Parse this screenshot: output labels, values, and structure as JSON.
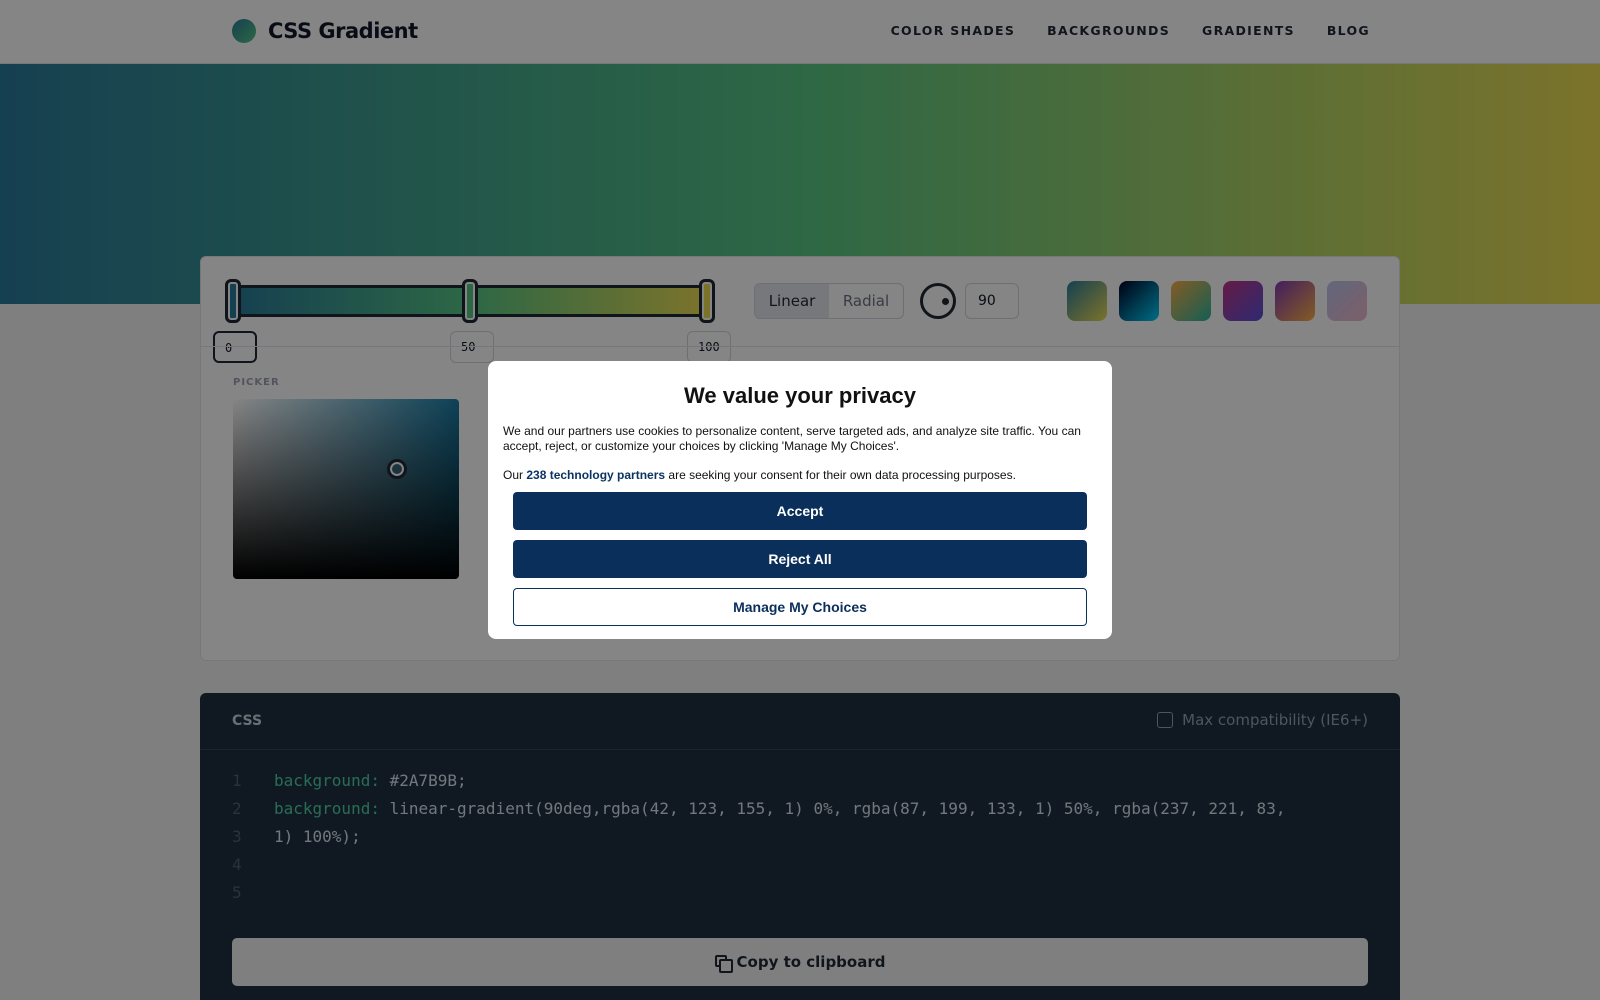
{
  "header": {
    "logo_text": "CSS Gradient",
    "nav": [
      "COLOR SHADES",
      "BACKGROUNDS",
      "GRADIENTS",
      "BLOG"
    ]
  },
  "gradient": {
    "type": "Linear",
    "angle": "90",
    "colors": [
      "#2A7B9B",
      "#57C785",
      "#EDDD53"
    ],
    "stops": [
      "0",
      "50",
      "100"
    ],
    "active_stop": "0"
  },
  "editor": {
    "type_options": [
      "Linear",
      "Radial"
    ],
    "picker_label": "PICKER",
    "picker_hue_color": "#1a7fa8",
    "presets": [
      {
        "from": "#2A7B9B",
        "to": "#EDDD53"
      },
      {
        "from": "#020024",
        "to": "#00D4FF"
      },
      {
        "from": "#FCB045",
        "to": "#2AB5A0"
      },
      {
        "from": "#C13584",
        "to": "#5851DB"
      },
      {
        "from": "#833AB4",
        "to": "#FCB045"
      },
      {
        "from": "#BBC5F0",
        "to": "#F0B8C8"
      }
    ]
  },
  "css_panel": {
    "title": "CSS",
    "compat_label": "Max compatibility (IE6+)",
    "line_numbers": [
      "1",
      "2",
      "3",
      "4",
      "5"
    ],
    "line1_prop": "background:",
    "line1_val": " #2A7B9B;",
    "line2_prop": "background:",
    "line2_val": " linear-gradient(90deg,rgba(42, 123, 155, 1) 0%, rgba(87, 199, 133, 1) 50%, rgba(237, 221, 83,",
    "line3_val": "1) 100%);",
    "copy_label": "Copy to clipboard"
  },
  "consent": {
    "title": "We value your privacy",
    "body": "We and our partners use cookies to personalize content, serve targeted ads, and analyze site traffic. You can accept, reject, or customize your choices by clicking 'Manage My Choices'.",
    "partners_prefix": "Our ",
    "partners_link": "238 technology partners",
    "partners_suffix": " are seeking your consent for their own data processing purposes.",
    "accept": "Accept",
    "reject": "Reject All",
    "manage": "Manage My Choices"
  }
}
